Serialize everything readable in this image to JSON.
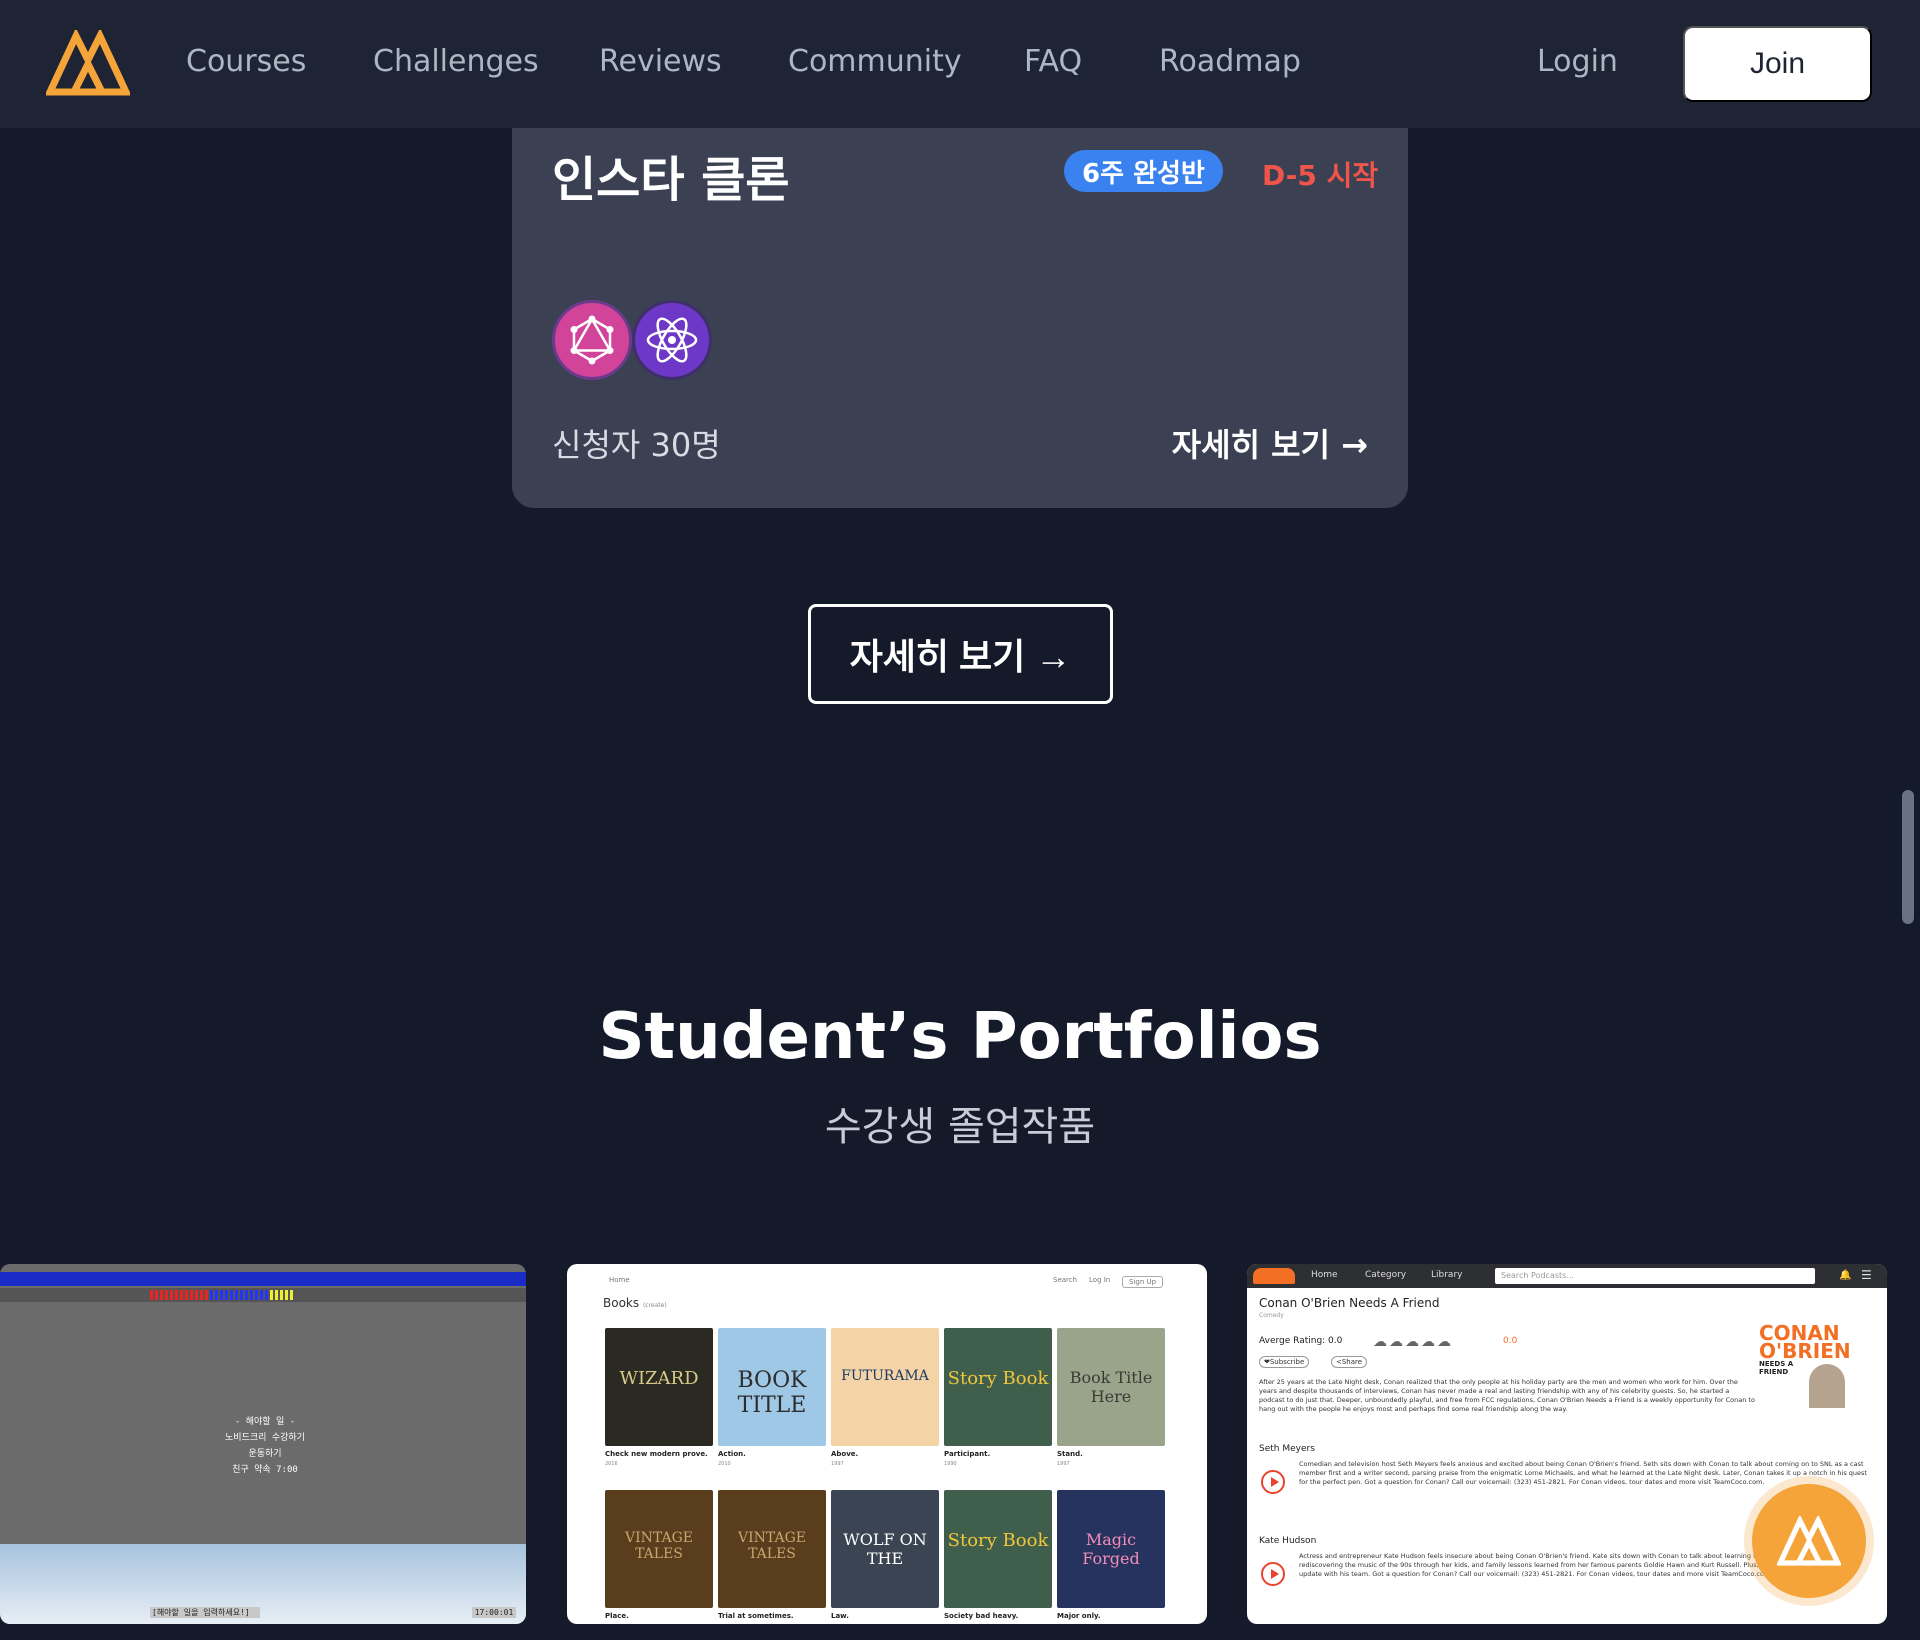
{
  "nav": {
    "links": [
      "Courses",
      "Challenges",
      "Reviews",
      "Community",
      "FAQ",
      "Roadmap"
    ],
    "login": "Login",
    "join": "Join"
  },
  "course_card": {
    "title": "인스타 클론",
    "badge": "6주 완성반",
    "dday": "D-5 시작",
    "applicants": "신청자 30명",
    "more_link": "자세히 보기 →",
    "tech_icons": [
      "graphql-icon",
      "react-icon"
    ]
  },
  "more_button": "자세히 보기 →",
  "portfolios": {
    "title": "Student’s Portfolios",
    "subtitle": "수강생 졸업작품",
    "game": {
      "messages": [
        "- 해야할 일 -",
        "노비드크리 수강하기",
        "운동하기",
        "친구 약속 7:00"
      ],
      "input_text": "[해야할 일을 입력하세요!]",
      "clock": "17:00:01"
    },
    "books": {
      "nav": [
        "Home",
        "Search",
        "Log In",
        "Sign Up"
      ],
      "heading": "Books",
      "heading_tag": "(create)",
      "items": [
        {
          "cover": "WIZARD",
          "caption": "Check new modern prove.",
          "year": "2016"
        },
        {
          "cover": "BOOK TITLE",
          "caption": "Action.",
          "year": "2010"
        },
        {
          "cover": "FUTURAMA",
          "caption": "Above.",
          "year": "1997"
        },
        {
          "cover": "Story Book",
          "caption": "Participant.",
          "year": "1990"
        },
        {
          "cover": "Book Title Here",
          "caption": "Stand.",
          "year": "1997"
        },
        {
          "cover": "VINTAGE TALES",
          "caption": "Place.",
          "year": ""
        },
        {
          "cover": "VINTAGE TALES",
          "caption": "Trial at sometimes.",
          "year": ""
        },
        {
          "cover": "WOLF ON THE",
          "caption": "Law.",
          "year": ""
        },
        {
          "cover": "Story Book",
          "caption": "Society bad heavy.",
          "year": ""
        },
        {
          "cover": "Magic Forged",
          "caption": "Major only.",
          "year": ""
        }
      ]
    },
    "podcast": {
      "nav": [
        "Home",
        "Category",
        "Library"
      ],
      "search_placeholder": "Search Podcasts...",
      "title": "Conan O'Brien Needs A Friend",
      "category": "Comedy",
      "rating_label": "Averge Rating: 0.0",
      "rating_value": "0.0",
      "subscribe": "❤Subscribe",
      "share": "<Share",
      "description": "After 25 years at the Late Night desk, Conan realized that the only people at his holiday party are the men and women who work for him. Over the years and despite thousands of interviews, Conan has never made a real and lasting friendship with any of his celebrity guests. So, he started a podcast to do just that. Deeper, unboundedly playful, and free from FCC regulations, Conan O'Brien Needs a Friend is a weekly opportunity for Conan to hang out with the people he enjoys most and perhaps find some real friendship along the way.",
      "logo_text": [
        "CONAN",
        "O'BRIEN",
        "NEEDS A FRIEND"
      ],
      "episodes": [
        {
          "name": "Seth Meyers",
          "text": "Comedian and television host Seth Meyers feels anxious and excited about being Conan O'Brien's friend. Seth sits down with Conan to talk about coming on to SNL as a cast member first and a writer second, parsing praise from the enigmatic Lorne Michaels, and what he learned at the Late Night desk. Later, Conan takes it up a notch in his quest for the perfect pen. Got a question for Conan? Call our voicemail: (323) 451-2821. For Conan videos, tour dates and more visit TeamCoco.com."
        },
        {
          "name": "Kate Hudson",
          "text": "Actress and entrepreneur Kate Hudson feels insecure about being Conan O'Brien's friend. Kate sits down with Conan to talk about learning to be a good salesperson, rediscovering the music of the 90s through her kids, and family lessons learned from her famous parents Goldie Hawn and Kurt Russell. Plus, Conan shares an urgent news update with his team. Got a question for Conan? Call our voicemail: (323) 451-2821. For Conan videos, tour dates and more visit TeamCoco.com."
        }
      ]
    }
  },
  "colors": {
    "background": "#141a2a",
    "nav": "#1e2433",
    "card": "#3b4152",
    "brand": "#f5a43a",
    "badge": "#3a82f0",
    "dday": "#f0554a"
  }
}
